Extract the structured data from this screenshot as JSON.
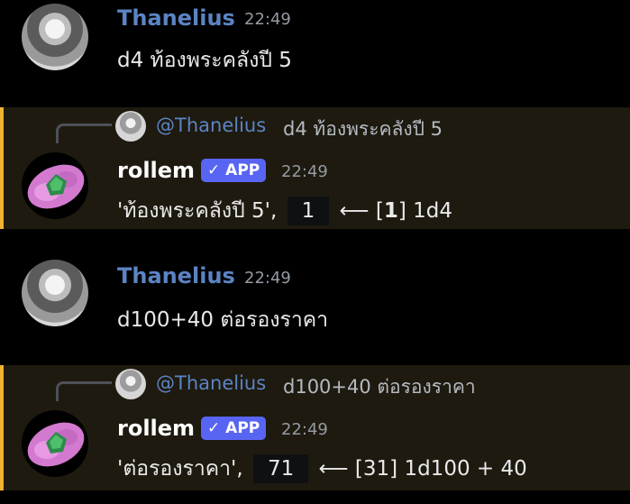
{
  "colors": {
    "background": "#000000",
    "highlight_bg": "#1e1a0f",
    "highlight_bar": "#f0b232",
    "user_name": "#5b84c4",
    "app_badge": "#5865f2",
    "timestamp": "#949ba4"
  },
  "messages": [
    {
      "author": "Thanelius",
      "time": "22:49",
      "text": "d4 ท้องพระคลังปี 5"
    },
    {
      "reply": {
        "mention": "@Thanelius",
        "text": "d4 ท้องพระคลังปี 5"
      },
      "author": "rollem",
      "badge_icon": "checkmark-icon",
      "badge": "APP",
      "time": "22:49",
      "result": {
        "prefix": "'ท้องพระคลังปี 5',",
        "total": "1",
        "arrow": "⟵",
        "roll_open": "[",
        "roll_value": "1",
        "roll_close": "]",
        "dice": "1d4"
      }
    },
    {
      "author": "Thanelius",
      "time": "22:49",
      "text": "d100+40 ต่อรองราคา"
    },
    {
      "reply": {
        "mention": "@Thanelius",
        "text": "d100+40 ต่อรองราคา"
      },
      "author": "rollem",
      "badge_icon": "checkmark-icon",
      "badge": "APP",
      "time": "22:49",
      "result": {
        "prefix": "'ต่อรองราคา',",
        "total": "71",
        "arrow": "⟵",
        "roll_open": "[",
        "roll_value": "31",
        "roll_close": "]",
        "dice": "1d100 + 40"
      }
    }
  ]
}
